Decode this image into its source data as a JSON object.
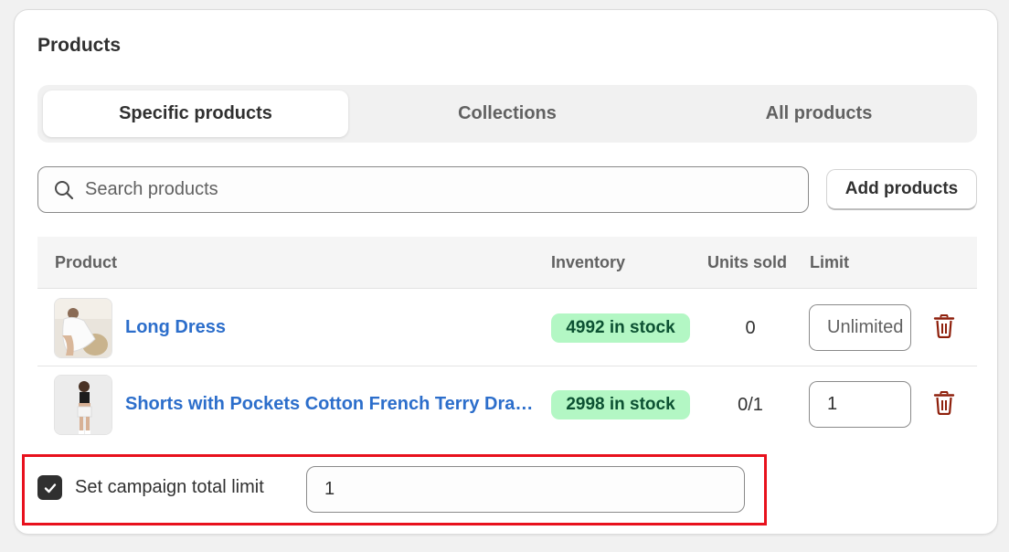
{
  "card": {
    "title": "Products"
  },
  "tabs": [
    {
      "label": "Specific products",
      "active": true
    },
    {
      "label": "Collections",
      "active": false
    },
    {
      "label": "All products",
      "active": false
    }
  ],
  "search": {
    "placeholder": "Search products",
    "icon": "search-icon"
  },
  "add_button": {
    "label": "Add products"
  },
  "table": {
    "headers": {
      "product": "Product",
      "inventory": "Inventory",
      "units_sold": "Units sold",
      "limit": "Limit"
    },
    "rows": [
      {
        "name": "Long Dress",
        "inventory": "4992 in stock",
        "units_sold": "0",
        "limit_value": "",
        "limit_placeholder": "Unlimited",
        "delete_icon": "trash-icon"
      },
      {
        "name": "Shorts with Pockets Cotton French Terry Drawstring",
        "inventory": "2998 in stock",
        "units_sold": "0/1",
        "limit_value": "1",
        "limit_placeholder": "",
        "delete_icon": "trash-icon"
      }
    ]
  },
  "campaign_limit": {
    "label": "Set campaign total limit",
    "checked": true,
    "value": "1"
  },
  "colors": {
    "link": "#2c6ecb",
    "badge_bg": "#b3f7c4",
    "badge_text": "#0c5132",
    "delete": "#8e1f0b",
    "highlight": "#e8111d",
    "checkbox": "#303030"
  }
}
